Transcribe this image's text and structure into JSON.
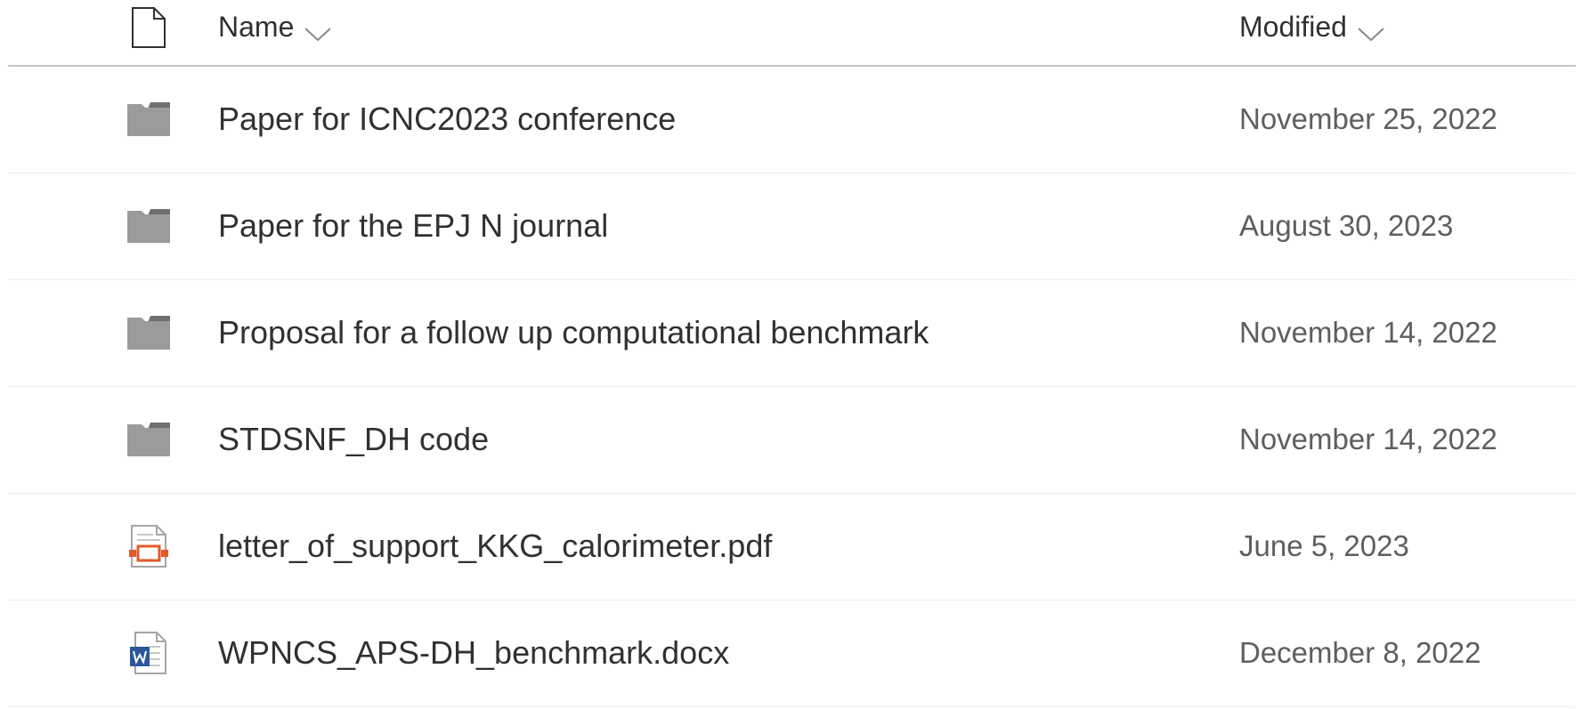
{
  "header": {
    "name_label": "Name",
    "modified_label": "Modified",
    "type_icon": "document-icon",
    "sort_icon": "chevron-down-icon"
  },
  "files": [
    {
      "name": "Paper for ICNC2023 conference",
      "modified": "November 25, 2022",
      "icon": "folder-icon"
    },
    {
      "name": "Paper for the EPJ N journal",
      "modified": "August 30, 2023",
      "icon": "folder-icon"
    },
    {
      "name": "Proposal for a follow up computational benchmark",
      "modified": "November 14, 2022",
      "icon": "folder-icon"
    },
    {
      "name": "STDSNF_DH code",
      "modified": "November 14, 2022",
      "icon": "folder-icon"
    },
    {
      "name": "letter_of_support_KKG_calorimeter.pdf",
      "modified": "June 5, 2023",
      "icon": "pdf-file-icon"
    },
    {
      "name": "WPNCS_APS-DH_benchmark.docx",
      "modified": "December 8, 2022",
      "icon": "word-file-icon"
    }
  ],
  "colors": {
    "folder": "#9b9b9b",
    "folder_tab": "#6f6f6f",
    "pdf_accent": "#e35a2a",
    "word_accent": "#2b579a",
    "divider": "#ededed",
    "header_divider": "#c8c6c4"
  }
}
